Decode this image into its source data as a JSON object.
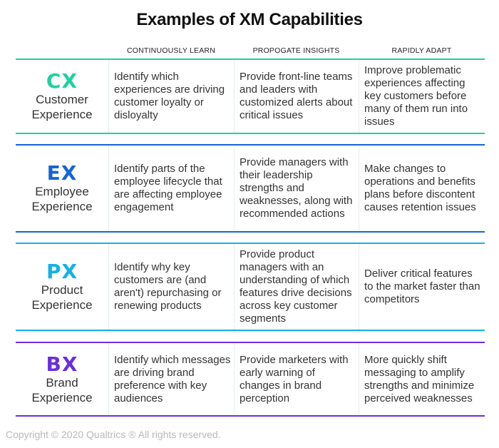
{
  "title": "Examples of XM Capabilities",
  "columns": [
    "CONTINUOUSLY LEARN",
    "PROPOGATE INSIGHTS",
    "RAPIDLY ADAPT"
  ],
  "rows": [
    {
      "abbr": "CX",
      "name_line1": "Customer",
      "name_line2": "Experience",
      "color": "#1fd1a1",
      "cells": [
        "Identify which experiences are driving customer loyalty or disloyalty",
        "Provide front-line teams and leaders with customized alerts about critical issues",
        "Improve problematic experiences affecting key customers before many of them run into issues"
      ]
    },
    {
      "abbr": "EX",
      "name_line1": "Employee",
      "name_line2": "Experience",
      "color": "#1565d8",
      "cells": [
        "Identify parts of the employee lifecycle that are affecting employee engagement",
        "Provide managers with their leadership strengths and weaknesses, along with recommended actions",
        "Make changes to operations and benefits plans before discontent causes retention issues"
      ]
    },
    {
      "abbr": "PX",
      "name_line1": "Product",
      "name_line2": "Experience",
      "color": "#12b2e8",
      "cells": [
        "Identify why key customers are (and aren't) repurchasing or renewing products",
        "Provide product managers with an understanding of which features drive decisions across key customer segments",
        "Deliver critical features to the market faster than competitors"
      ]
    },
    {
      "abbr": "BX",
      "name_line1": "Brand",
      "name_line2": "Experience",
      "color": "#6a2ee0",
      "cells": [
        "Identify which messages are driving brand preference with key audiences",
        "Provide marketers with early warning of changes in brand perception",
        "More quickly shift messaging to amplify strengths and minimize perceived weaknesses"
      ]
    }
  ],
  "copyright": "Copyright © 2020 Qualtrics ® All rights reserved."
}
